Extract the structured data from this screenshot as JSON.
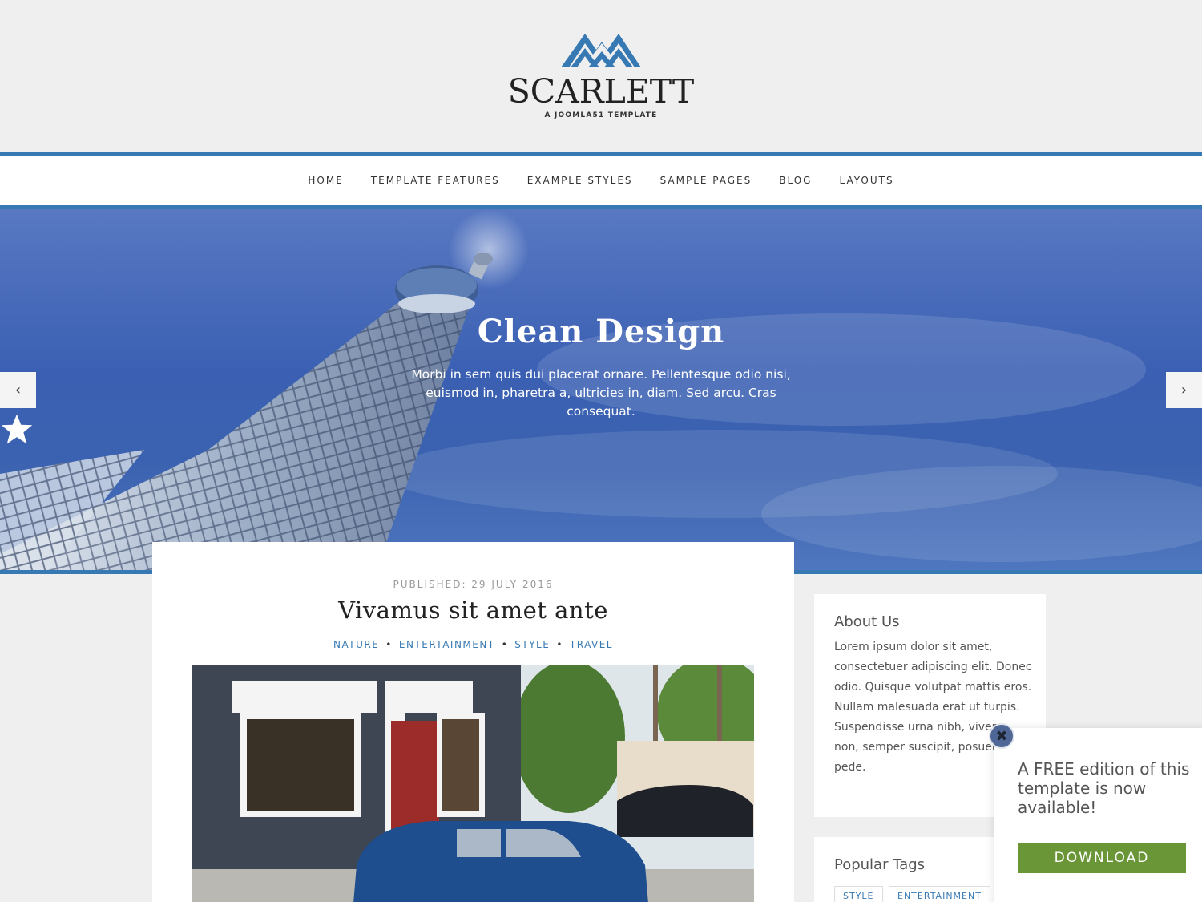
{
  "site": {
    "title": "SCARLETT",
    "subtitle": "A JOOMLA51 TEMPLATE"
  },
  "nav": {
    "items": [
      "HOME",
      "TEMPLATE FEATURES",
      "EXAMPLE STYLES",
      "SAMPLE PAGES",
      "BLOG",
      "LAYOUTS"
    ]
  },
  "slider": {
    "title": "Clean Design",
    "text": "Morbi in sem quis dui placerat ornare. Pellentesque odio nisi, euismod in, pharetra a, ultricies in, diam. Sed arcu. Cras consequat.",
    "prev_icon": "‹",
    "next_icon": "›"
  },
  "article": {
    "published": "PUBLISHED: 29 JULY 2016",
    "title": "Vivamus sit amet ante",
    "tags": [
      "NATURE",
      "ENTERTAINMENT",
      "STYLE",
      "TRAVEL"
    ]
  },
  "sidebar": {
    "about_title": "About Us",
    "about_text": "Lorem ipsum dolor sit amet, consectetuer adipiscing elit. Donec odio. Quisque volutpat mattis eros. Nullam malesuada erat ut turpis. Suspendisse urna nibh, viverra non, semper suscipit, posuere a, pede.",
    "tags_title": "Popular Tags",
    "tags": [
      "STYLE",
      "ENTERTAINMENT"
    ]
  },
  "popup": {
    "text": "A FREE edition of this template is now available!",
    "button": "DOWNLOAD",
    "close": "✖"
  },
  "colors": {
    "accent": "#3779b3",
    "download": "#6a9637"
  }
}
